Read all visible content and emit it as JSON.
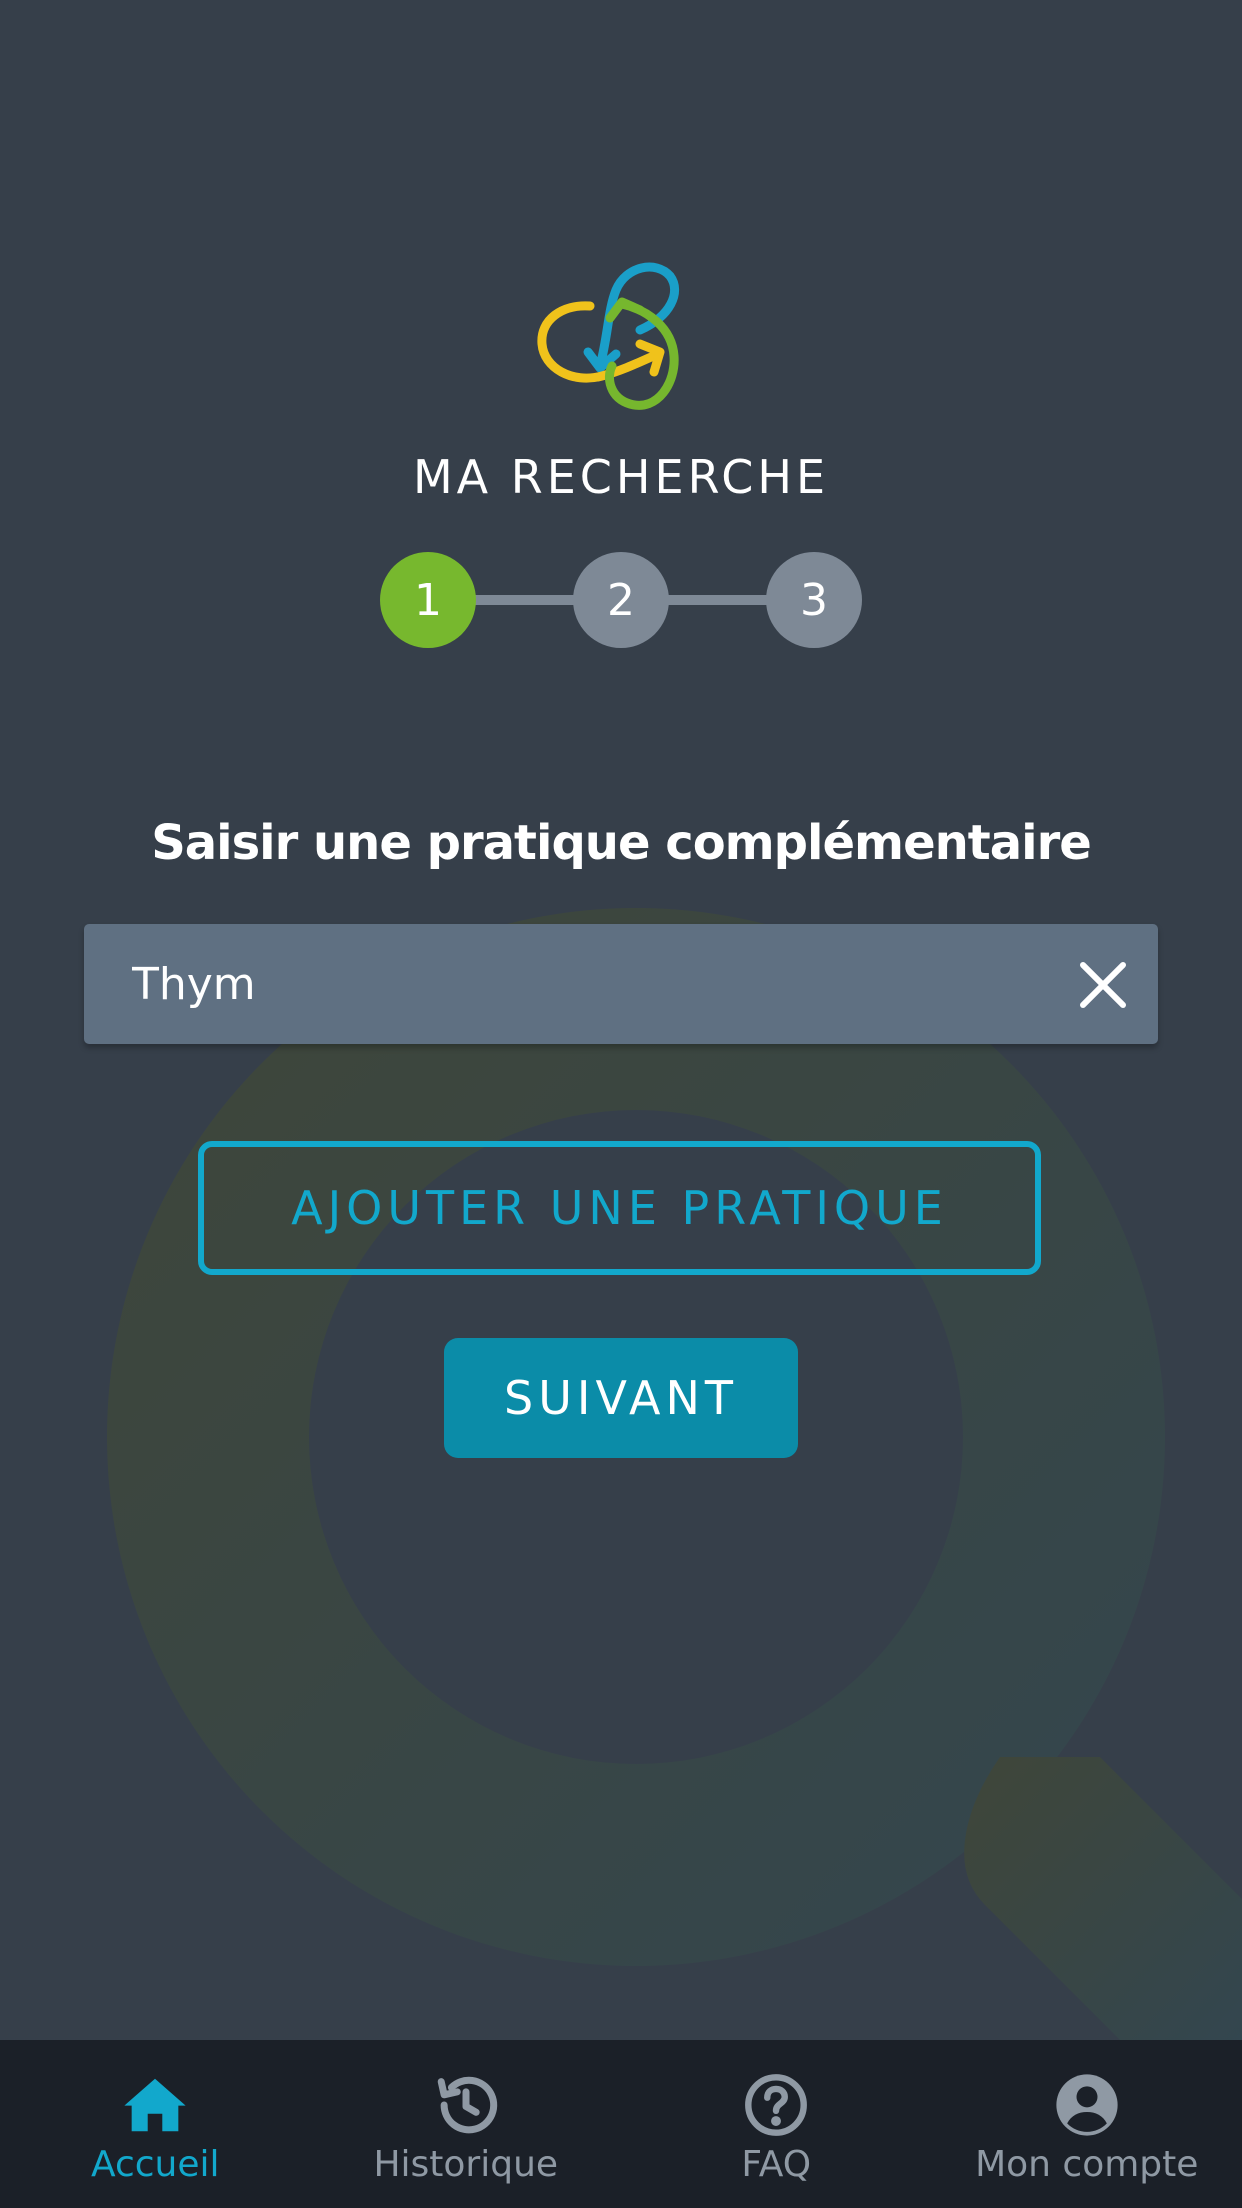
{
  "brand": {
    "logo_icon": "circular-arrows-logo-icon",
    "name": "MA RECHERCHE"
  },
  "stepper": {
    "steps": [
      "1",
      "2",
      "3"
    ],
    "current_step": 1
  },
  "form": {
    "heading": "Saisir une pratique complémentaire",
    "input_value": "Thym",
    "clear_icon": "close-icon",
    "add_button_label": "AJOUTER UNE PRATIQUE",
    "next_button_label": "SUIVANT"
  },
  "tabbar": {
    "items": [
      {
        "label": "Accueil",
        "icon": "home-icon",
        "active": true
      },
      {
        "label": "Historique",
        "icon": "history-icon",
        "active": false
      },
      {
        "label": "FAQ",
        "icon": "help-circle-icon",
        "active": false
      },
      {
        "label": "Mon compte",
        "icon": "account-circle-icon",
        "active": false
      }
    ]
  },
  "colors": {
    "background": "#363f4a",
    "accent": "#12a8cc",
    "primary_button": "#0b8ca8",
    "step_active": "#77b82e",
    "step_inactive": "#7e8996",
    "input_bg": "#5f7082",
    "tabbar_bg": "#1b2028"
  }
}
